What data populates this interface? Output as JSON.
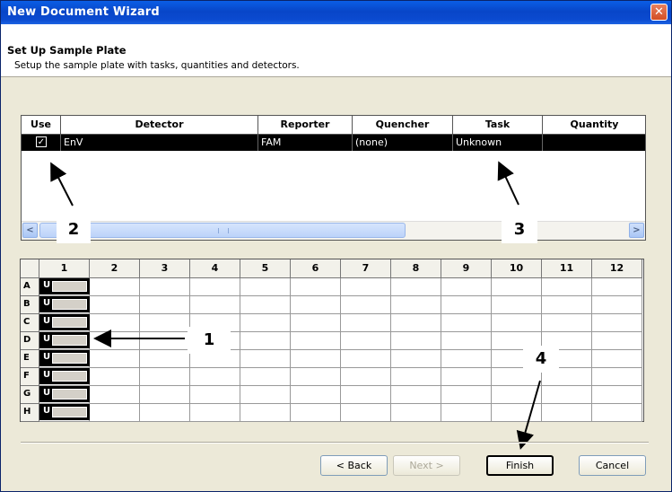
{
  "window": {
    "title": "New Document Wizard",
    "close_glyph": "✕"
  },
  "header": {
    "title": "Set Up Sample Plate",
    "subtitle": "Setup the sample plate with tasks, quantities and detectors."
  },
  "detector_table": {
    "columns": [
      "Use",
      "Detector",
      "Reporter",
      "Quencher",
      "Task",
      "Quantity"
    ],
    "rows": [
      {
        "use": true,
        "use_glyph": "✓",
        "detector": "EnV",
        "reporter": "FAM",
        "quencher": "(none)",
        "task": "Unknown",
        "quantity": ""
      }
    ],
    "scroll_left": "<",
    "scroll_right": ">"
  },
  "plate": {
    "columns": [
      "1",
      "2",
      "3",
      "4",
      "5",
      "6",
      "7",
      "8",
      "9",
      "10",
      "11",
      "12"
    ],
    "rows": [
      "A",
      "B",
      "C",
      "D",
      "E",
      "F",
      "G",
      "H"
    ],
    "well_task_label": "U"
  },
  "callouts": {
    "one": "1",
    "two": "2",
    "three": "3",
    "four": "4"
  },
  "buttons": {
    "back": "< Back",
    "next": "Next >",
    "finish": "Finish",
    "cancel": "Cancel"
  }
}
